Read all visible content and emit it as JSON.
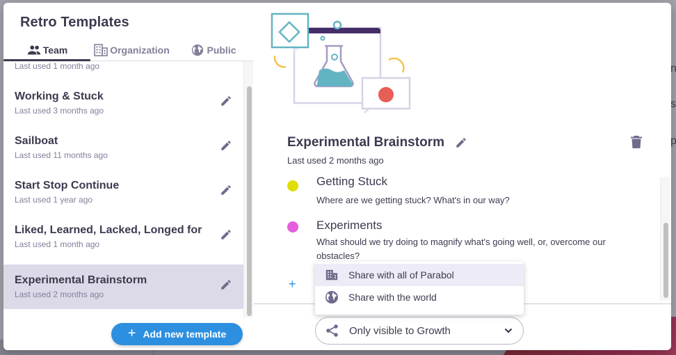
{
  "modal": {
    "title": "Retro Templates",
    "tabs": [
      {
        "label": "Team",
        "icon": "team-icon",
        "active": true
      },
      {
        "label": "Organization",
        "icon": "organization-icon",
        "active": false
      },
      {
        "label": "Public",
        "icon": "public-icon",
        "active": false
      }
    ],
    "templates": [
      {
        "name": "",
        "meta": "Last used 1 month ago",
        "selected": false
      },
      {
        "name": "Working & Stuck",
        "meta": "Last used 3 months ago",
        "selected": false
      },
      {
        "name": "Sailboat",
        "meta": "Last used 11 months ago",
        "selected": false
      },
      {
        "name": "Start Stop Continue",
        "meta": "Last used 1 year ago",
        "selected": false
      },
      {
        "name": "Liked, Learned, Lacked, Longed for",
        "meta": "Last used 1 month ago",
        "selected": false
      },
      {
        "name": "Experimental Brainstorm",
        "meta": "Last used 2 months ago",
        "selected": true
      }
    ],
    "add_button_label": "Add new template",
    "add_button_icon": "+"
  },
  "detail": {
    "title": "Experimental Brainstorm",
    "meta": "Last used 2 months ago",
    "prompts": [
      {
        "title": "Getting Stuck",
        "description": "Where are we getting stuck? What's in our way?",
        "color": "#e0de00"
      },
      {
        "title": "Experiments",
        "description": "What should we try doing to magnify what's going well, or, overcome our obstacles?",
        "color": "#e55fdd"
      }
    ],
    "add_prompt_icon": "+"
  },
  "share_menu": {
    "items": [
      {
        "label": "Share with all of Parabol",
        "icon": "organization-icon",
        "highlighted": true
      },
      {
        "label": "Share with the world",
        "icon": "public-icon",
        "highlighted": false
      }
    ]
  },
  "share_dropdown": {
    "value": "Only visible to Growth",
    "icon": "share-icon"
  },
  "colors": {
    "accent": "#2d8fe0",
    "text_primary": "#3d3a4f",
    "text_secondary": "#82809a",
    "selected_bg": "#dcdae9"
  },
  "background": {
    "fragments": [
      "ne",
      "s",
      "p"
    ]
  }
}
